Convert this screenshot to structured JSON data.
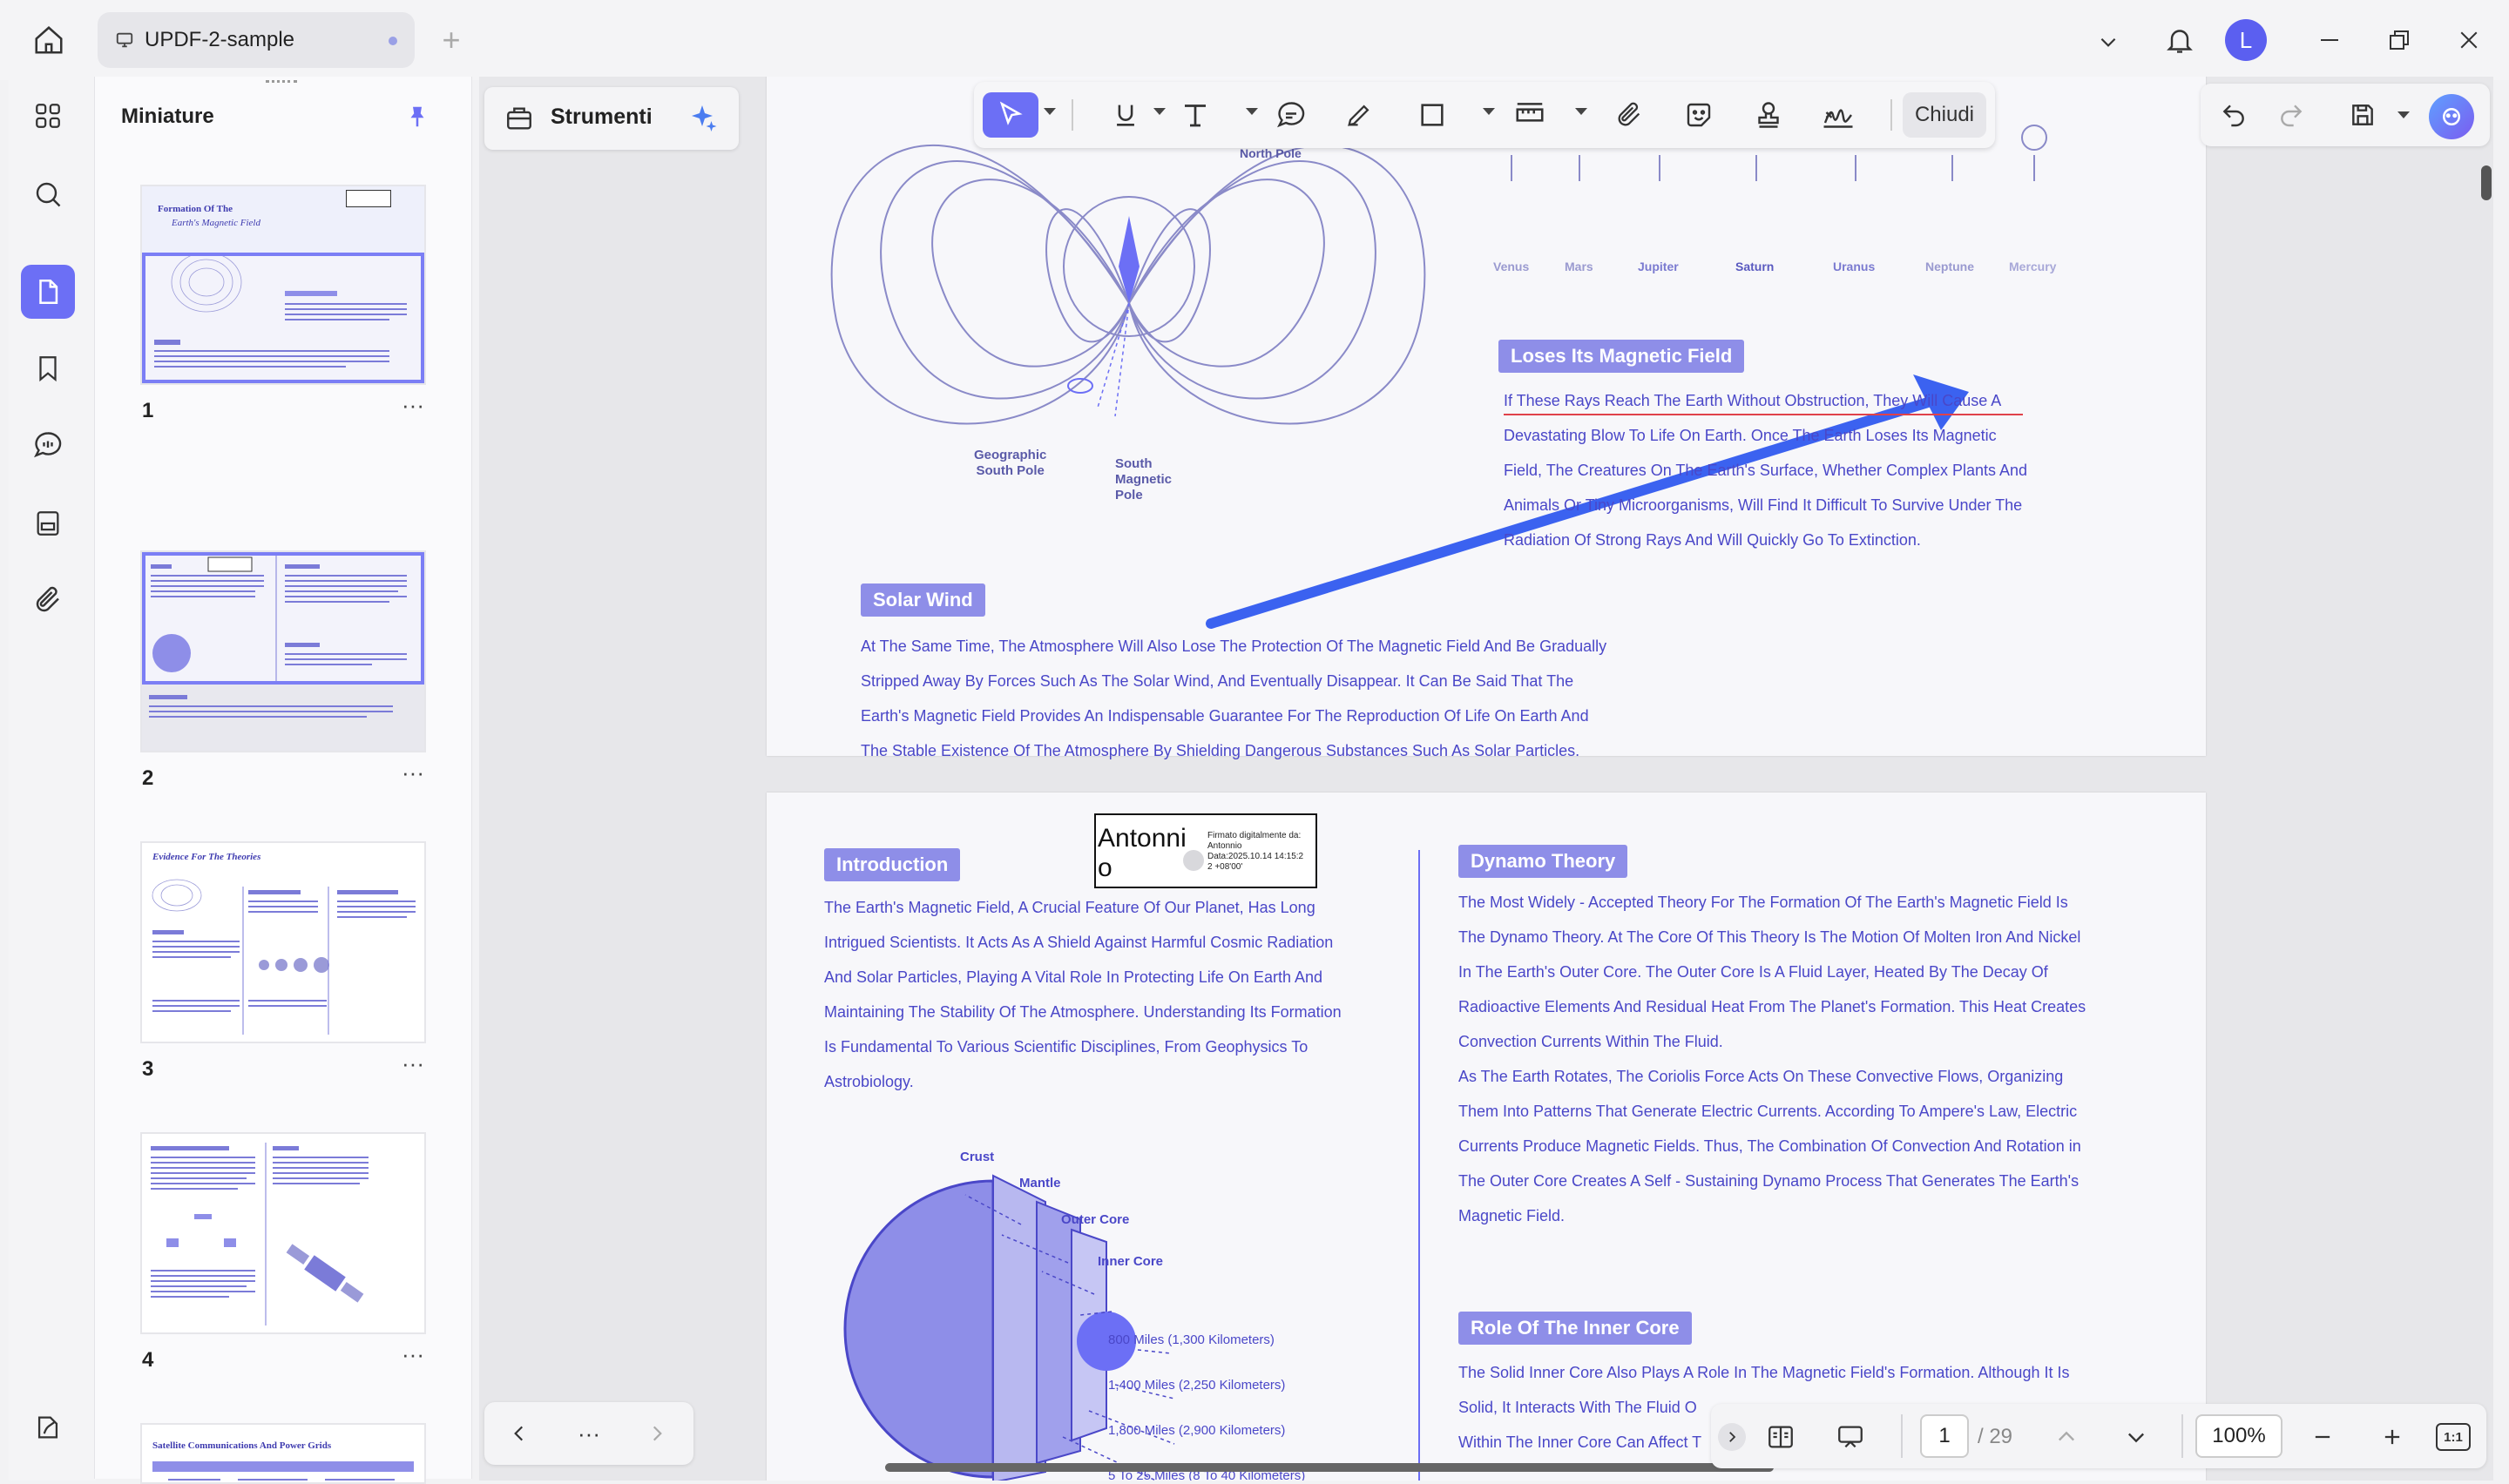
{
  "app": {
    "tab_title": "UPDF-2-sample",
    "avatar_letter": "L",
    "accent": "#6c6ff5"
  },
  "sidebar": {
    "title": "Miniature",
    "pages": [
      "1",
      "2",
      "3",
      "4"
    ]
  },
  "toolbar": {
    "strumenti_label": "Strumenti",
    "close_label": "Chiudi"
  },
  "pagination": {
    "current_page": "1",
    "total": "/ 29",
    "zoom": "100%",
    "fit_label": "1:1"
  },
  "page1": {
    "north_pole": "North Pole",
    "geo_south": "Geographic\nSouth Pole",
    "mag_south": "South\nMagnetic\nPole",
    "planets": [
      "Venus",
      "Mars",
      "Jupiter",
      "Saturn",
      "Uranus",
      "Neptune",
      "Mercury"
    ],
    "loses_title": "Loses Its Magnetic Field",
    "loses_lines": [
      "If These Rays Reach The Earth Without Obstruction, They Will Cause A",
      "Devastating Blow To Life On Earth. Once The Earth Loses Its Magnetic",
      "Field, The Creatures On The Earth's Surface, Whether Complex Plants And",
      "Animals Or Tiny Microorganisms, Will Find It Difficult To Survive Under The",
      "Radiation Of Strong Rays And Will Quickly Go To Extinction."
    ],
    "solar_title": "Solar Wind",
    "solar_lines": [
      "At The Same Time, The Atmosphere Will Also Lose The Protection Of The Magnetic Field And Be Gradually",
      "Stripped Away By Forces Such As The Solar Wind, And Eventually Disappear. It Can Be Said That The",
      "Earth's Magnetic Field Provides An Indispensable Guarantee For The Reproduction Of Life On Earth And",
      "The Stable Existence Of The Atmosphere By Shielding Dangerous Substances Such As Solar Particles."
    ]
  },
  "page2": {
    "intro_title": "Introduction",
    "intro_lines": [
      "The Earth's Magnetic Field, A Crucial Feature Of Our Planet, Has Long",
      "Intrigued Scientists. It Acts As A Shield Against Harmful Cosmic Radiation",
      "And Solar Particles, Playing A Vital Role In Protecting Life On Earth And",
      "Maintaining The Stability Of The Atmosphere. Understanding Its Formation",
      "Is Fundamental To Various Scientific Disciplines, From Geophysics To",
      "Astrobiology."
    ],
    "signature_name_1": "Antonni",
    "signature_name_2": "o",
    "signature_info": [
      "Firmato digitalmente da:",
      "Antonnio",
      "Data:2025.10.14 14:15:2",
      "2 +08'00'"
    ],
    "layers": [
      "Crust",
      "Mantle",
      "Outer Core",
      "Inner Core"
    ],
    "distances": [
      "800 Miles (1,300 Kilometers)",
      "1,400 Miles (2,250 Kilometers)",
      "1,800 Miles (2,900 Kilometers)",
      "5 To 25 Miles (8 To 40 Kilometers)"
    ],
    "dynamo_title": "Dynamo Theory",
    "dynamo_lines": [
      "The Most Widely - Accepted Theory For The Formation Of The Earth's Magnetic Field Is",
      "The Dynamo Theory. At The Core Of This Theory Is The Motion Of Molten Iron And Nickel",
      "In The Earth's Outer Core. The Outer Core Is A Fluid Layer, Heated By The Decay Of",
      "Radioactive Elements And Residual Heat From The Planet's Formation. This Heat Creates",
      "Convection Currents Within The Fluid.",
      "As The Earth Rotates, The Coriolis Force Acts On These Convective Flows, Organizing",
      "Them Into Patterns That Generate Electric Currents. According To Ampere's Law, Electric",
      "Currents Produce Magnetic Fields. Thus, The Combination Of Convection And Rotation in",
      "The Outer Core Creates A Self - Sustaining Dynamo Process That Generates The Earth's",
      "Magnetic Field."
    ],
    "inner_title": "Role Of The Inner Core",
    "inner_lines": [
      "The Solid Inner Core Also Plays A Role In The Magnetic Field's Formation. Although It Is",
      "Solid, It Interacts With The Fluid O",
      "Within The Inner Core Can Affect T"
    ]
  },
  "thumb_titles": {
    "t1a": "Formation Of The",
    "t1b": "Earth's Magnetic Field",
    "t3": "Evidence For The Theories",
    "t5": "Satellite Communications And Power Grids"
  }
}
